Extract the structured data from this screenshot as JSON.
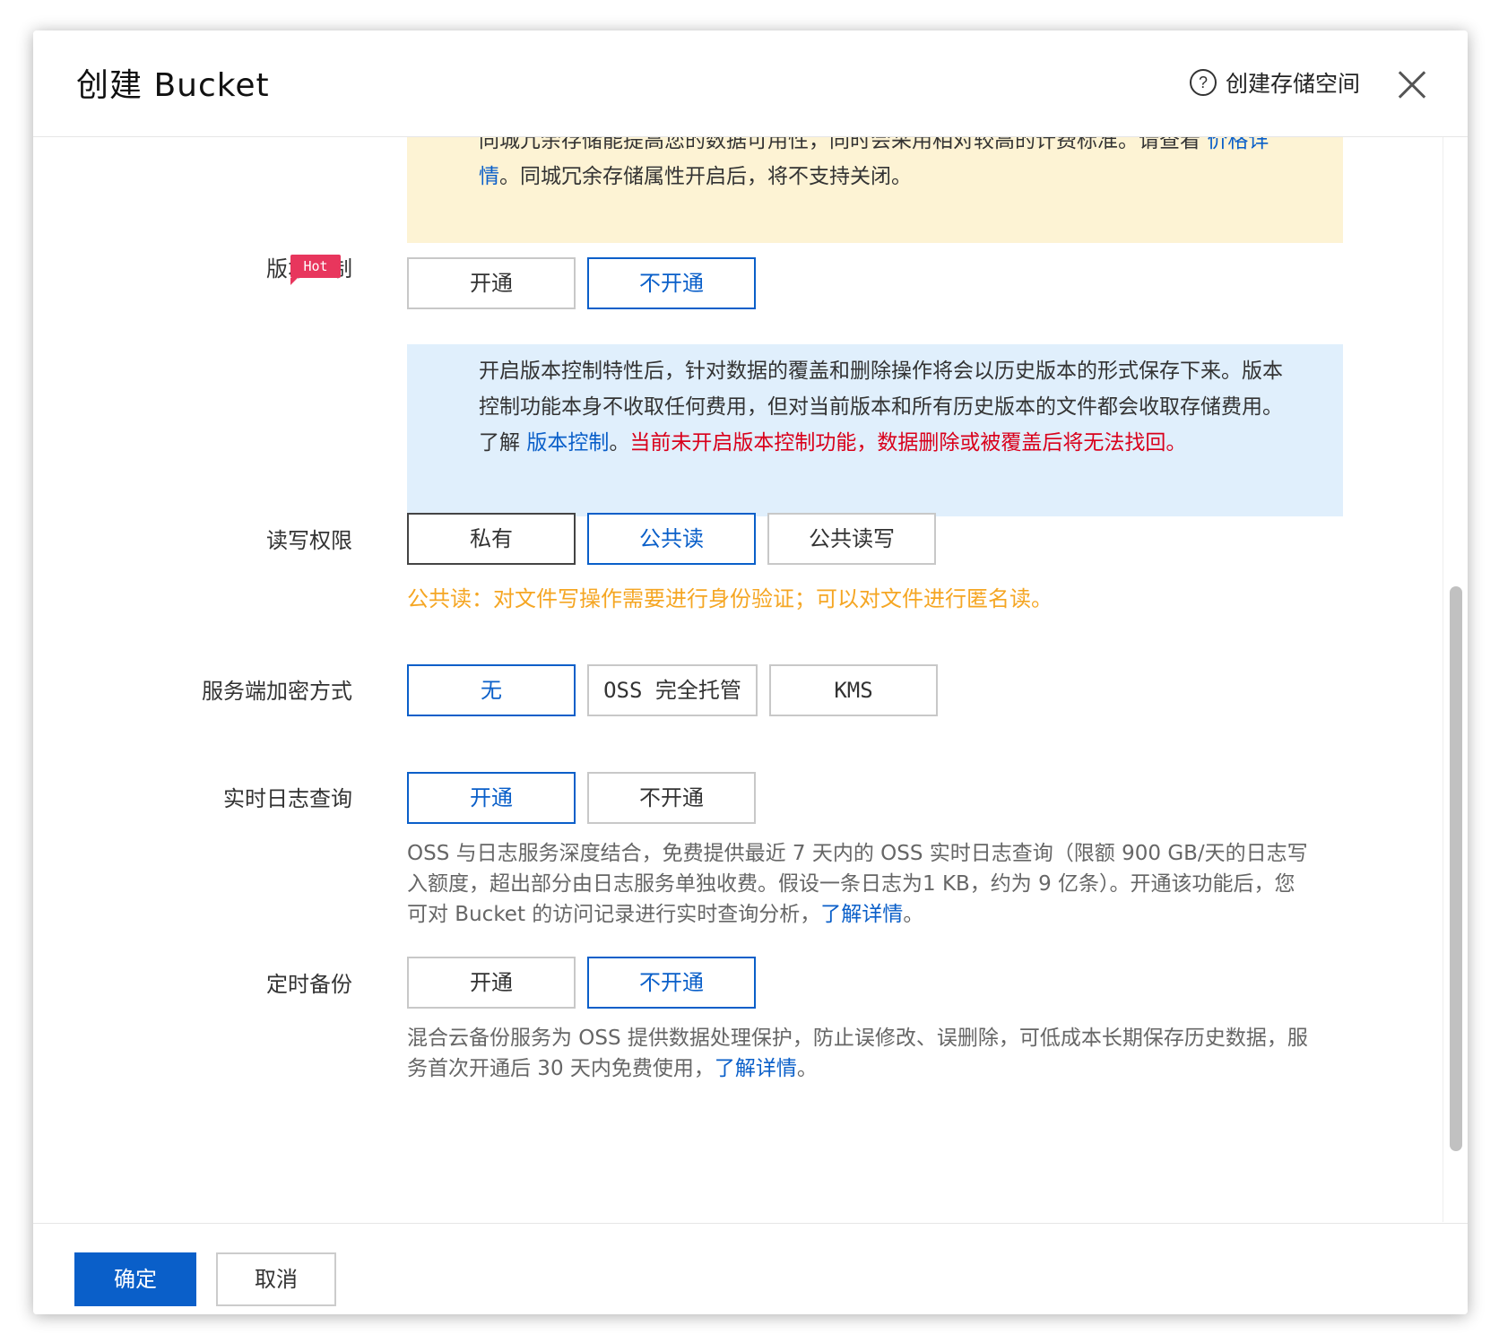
{
  "header": {
    "title": "创建 Bucket",
    "help_label": "创建存储空间",
    "help_icon_glyph": "?"
  },
  "redundancy_notice": {
    "line1": "同城冗余存储能提高您的数据可用性，同时会采用相对较高的计费标准。请查看",
    "link": "价格详情",
    "line2": "。同城冗余存储属性开启后，将不支持关闭。"
  },
  "versioning": {
    "label": "版本控制",
    "badge": "Hot",
    "options": [
      "开通",
      "不开通"
    ],
    "selected": "不开通",
    "notice_text": "开启版本控制特性后，针对数据的覆盖和删除操作将会以历史版本的形式保存下来。版本控制功能本身不收取任何费用，但对当前版本和所有历史版本的文件都会收取存储费用。了解 ",
    "notice_link": "版本控制",
    "notice_sep": "。",
    "notice_warning": "当前未开启版本控制功能，数据删除或被覆盖后将无法找回。"
  },
  "acl": {
    "label": "读写权限",
    "options": [
      "私有",
      "公共读",
      "公共读写"
    ],
    "selected": "公共读",
    "hint": "公共读：对文件写操作需要进行身份验证；可以对文件进行匿名读。"
  },
  "encryption": {
    "label": "服务端加密方式",
    "options": [
      "无",
      "OSS 完全托管",
      "KMS"
    ],
    "selected": "无"
  },
  "realtime_log": {
    "label": "实时日志查询",
    "options": [
      "开通",
      "不开通"
    ],
    "selected": "开通",
    "desc": "OSS 与日志服务深度结合，免费提供最近 7 天内的 OSS 实时日志查询（限额 900 GB/天的日志写入额度，超出部分由日志服务单独收费。假设一条日志为1 KB，约为 9 亿条）。开通该功能后，您可对 Bucket 的访问记录进行实时查询分析，",
    "link": "了解详情",
    "tail": "。"
  },
  "backup": {
    "label": "定时备份",
    "options": [
      "开通",
      "不开通"
    ],
    "selected": "不开通",
    "desc": "混合云备份服务为 OSS 提供数据处理保护，防止误修改、误删除，可低成本长期保存历史数据，服务首次开通后 30 天内免费使用，",
    "link": "了解详情",
    "tail": "。"
  },
  "footer": {
    "confirm": "确定",
    "cancel": "取消"
  },
  "colors": {
    "primary": "#0a5fc9",
    "warning_red": "#d9001b",
    "hint_orange": "#f5a623",
    "hot_badge": "#e8365d",
    "notice_yellow": "#fdf3d4",
    "notice_blue": "#e0effc"
  }
}
